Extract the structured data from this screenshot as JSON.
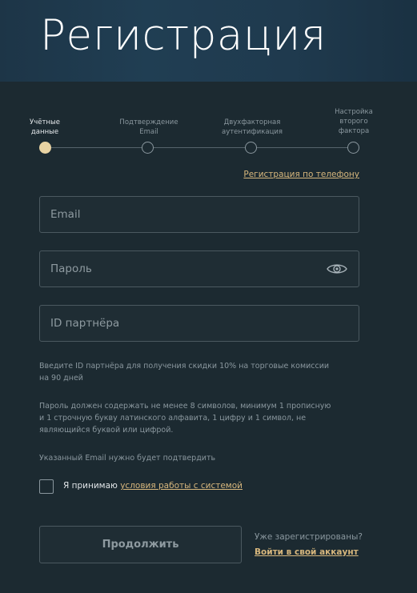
{
  "header": {
    "title": "Регистрация"
  },
  "steps": [
    {
      "line1": "Учётные",
      "line2": "данные",
      "line3": "",
      "active": true
    },
    {
      "line1": "Подтверждение",
      "line2": "Email",
      "line3": "",
      "active": false
    },
    {
      "line1": "Двухфакторная",
      "line2": "аутентификация",
      "line3": "",
      "active": false
    },
    {
      "line1": "Настройка",
      "line2": "второго",
      "line3": "фактора",
      "active": false
    }
  ],
  "phone_link": "Регистрация по телефону",
  "form": {
    "email_placeholder": "Email",
    "password_placeholder": "Пароль",
    "partner_placeholder": "ID партнёра"
  },
  "hints": {
    "partner_line1": "Введите ID партнёра для получения скидки 10% на торговые комиссии",
    "partner_line2": "на 90 дней",
    "password_line1": "Пароль должен содержать не менее 8 символов, минимум 1 прописную",
    "password_line2": "и 1 строчную букву латинского алфавита, 1 цифру и 1 символ, не",
    "password_line3": "являющийся буквой или цифрой.",
    "email_confirm": "Указанный Email нужно будет подтвердить"
  },
  "terms": {
    "prefix": "Я принимаю ",
    "link": "условия работы с системой"
  },
  "footer": {
    "continue_label": "Продолжить",
    "already_text": "Уже зарегистрированы?",
    "login_link": "Войти в свой аккаунт"
  },
  "colors": {
    "accent": "#d7b77d",
    "active_dot": "#e8d3a3",
    "background": "#1c2a31"
  },
  "icons": {
    "password_toggle": "eye-icon"
  }
}
